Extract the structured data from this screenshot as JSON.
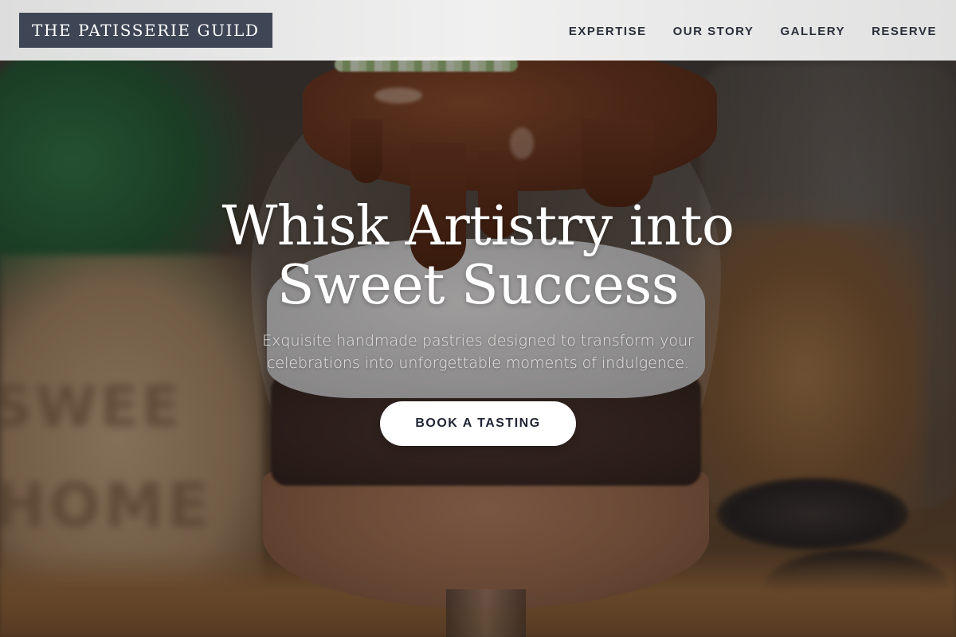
{
  "brand": {
    "logo_text": "THE PATISSERIE GUILD"
  },
  "nav": {
    "items": [
      {
        "label": "EXPERTISE"
      },
      {
        "label": "OUR STORY"
      },
      {
        "label": "GALLERY"
      },
      {
        "label": "RESERVE"
      }
    ]
  },
  "hero": {
    "headline": "Whisk Artistry into Sweet Success",
    "subtext": "Exquisite handmade pastries designed to transform your celebrations into unforgettable moments of indulgence.",
    "cta_label": "BOOK A TASTING",
    "background_sign_text": [
      "SWEE",
      "HOME"
    ]
  },
  "colors": {
    "logo_bg": "#3e4656",
    "nav_bg": "#f0f0f0",
    "nav_text": "#2a2f3a",
    "cta_bg": "#ffffff",
    "cta_text": "#1f2533",
    "headline_text": "#ffffff"
  }
}
